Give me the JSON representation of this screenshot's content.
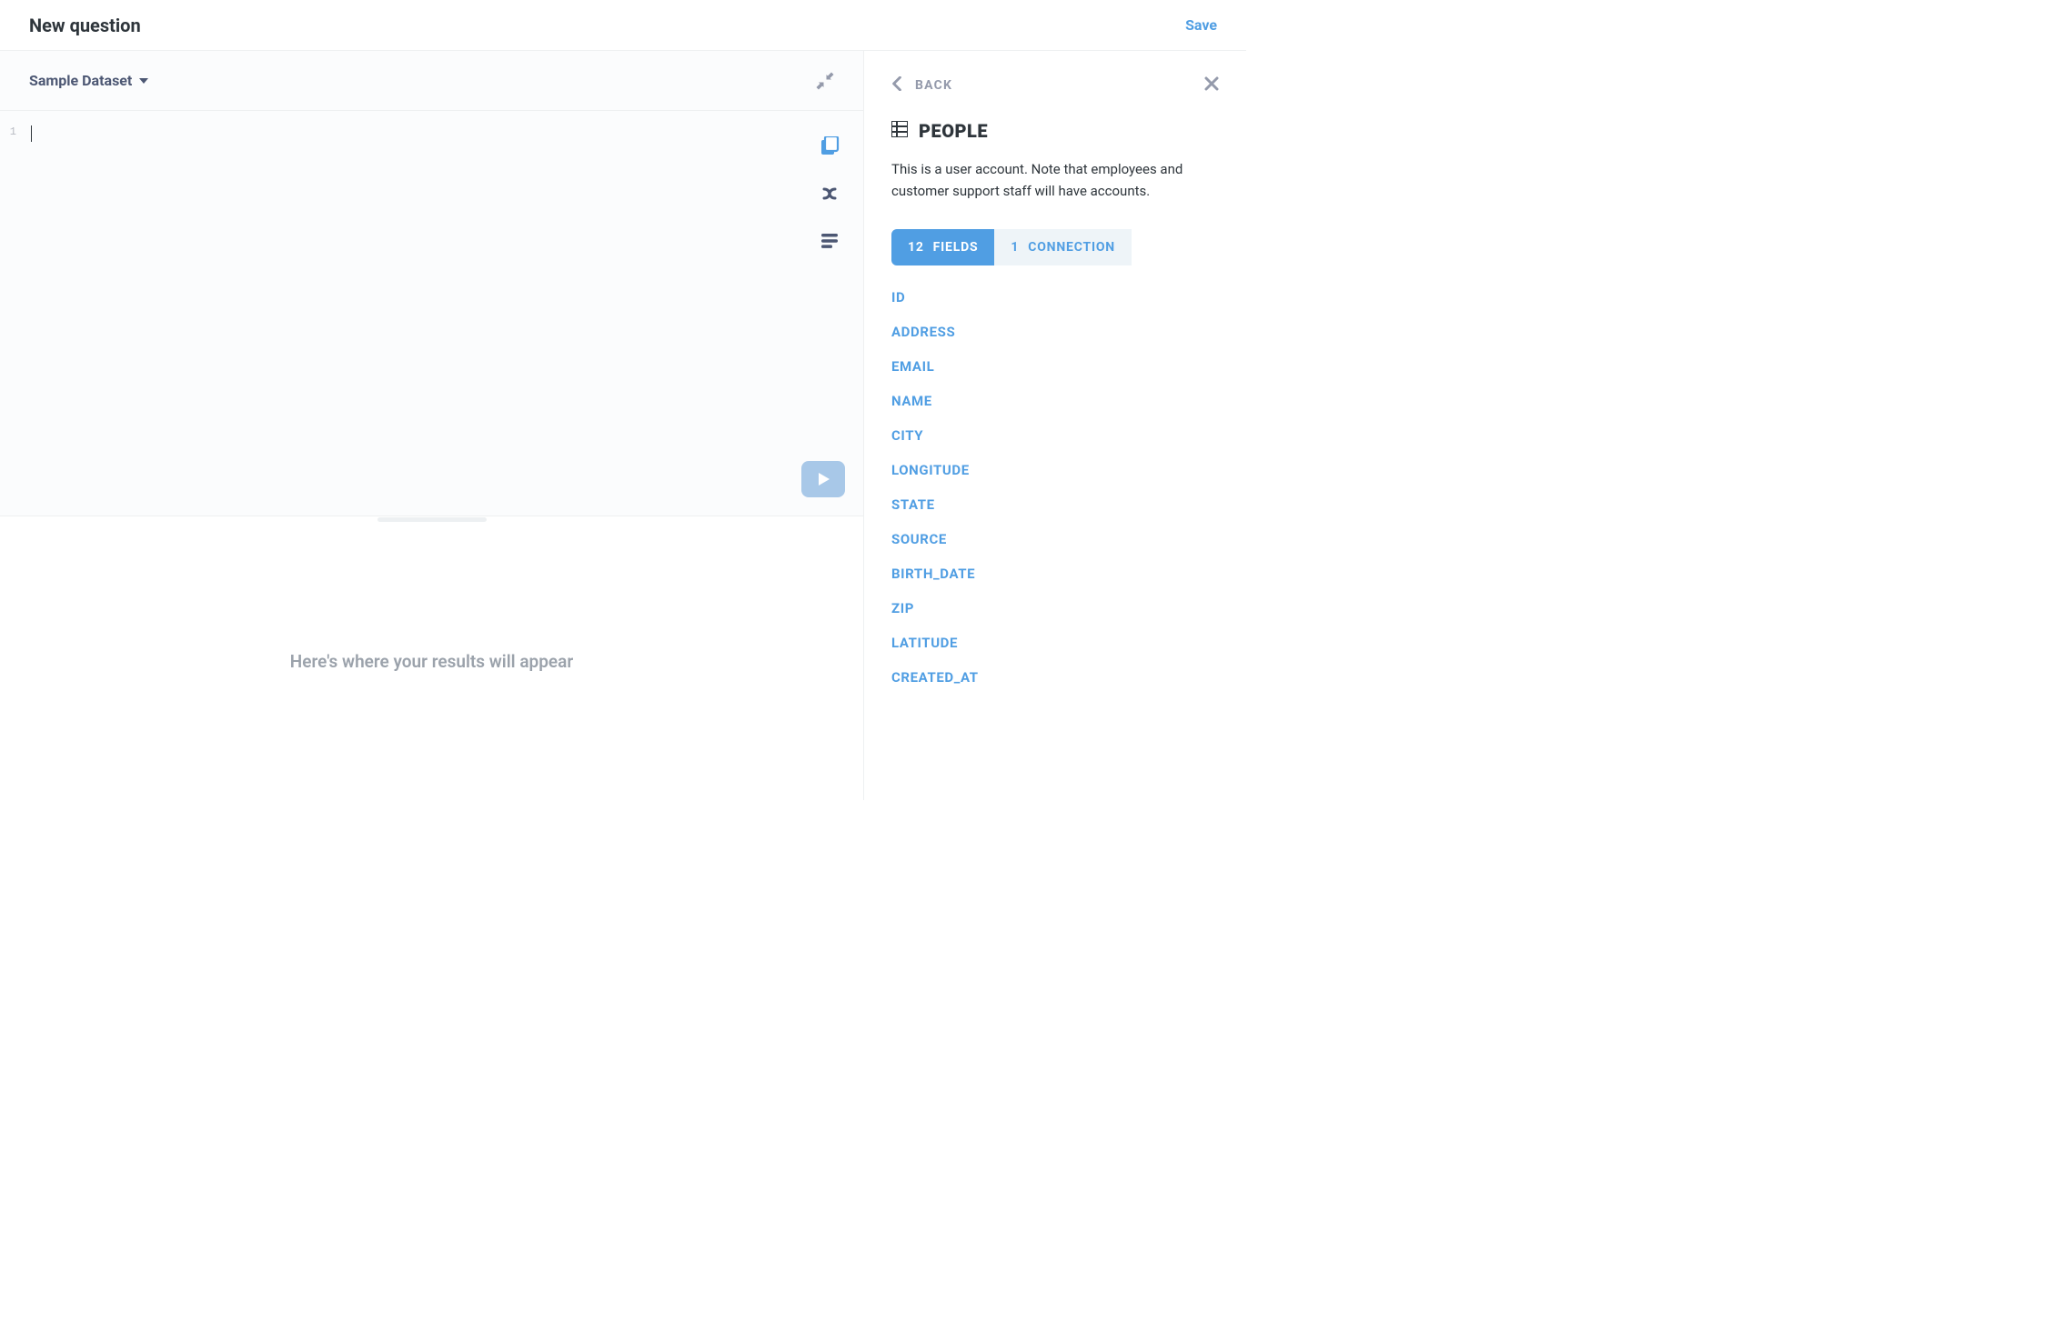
{
  "header": {
    "title": "New question",
    "save_label": "Save"
  },
  "editor": {
    "dataset_label": "Sample Dataset",
    "line_number": "1"
  },
  "results": {
    "placeholder": "Here's where your results will appear"
  },
  "panel": {
    "back_label": "BACK",
    "table_name": "PEOPLE",
    "table_desc": "This is a user account. Note that employees and customer support staff will have accounts.",
    "tabs": {
      "fields_count": "12",
      "fields_label": "FIELDS",
      "connections_count": "1",
      "connections_label": "CONNECTION"
    },
    "fields": [
      {
        "name": "ID"
      },
      {
        "name": "ADDRESS"
      },
      {
        "name": "EMAIL"
      },
      {
        "name": "NAME"
      },
      {
        "name": "CITY"
      },
      {
        "name": "LONGITUDE"
      },
      {
        "name": "STATE"
      },
      {
        "name": "SOURCE"
      },
      {
        "name": "BIRTH_DATE"
      },
      {
        "name": "ZIP"
      },
      {
        "name": "LATITUDE"
      },
      {
        "name": "CREATED_AT"
      }
    ]
  }
}
